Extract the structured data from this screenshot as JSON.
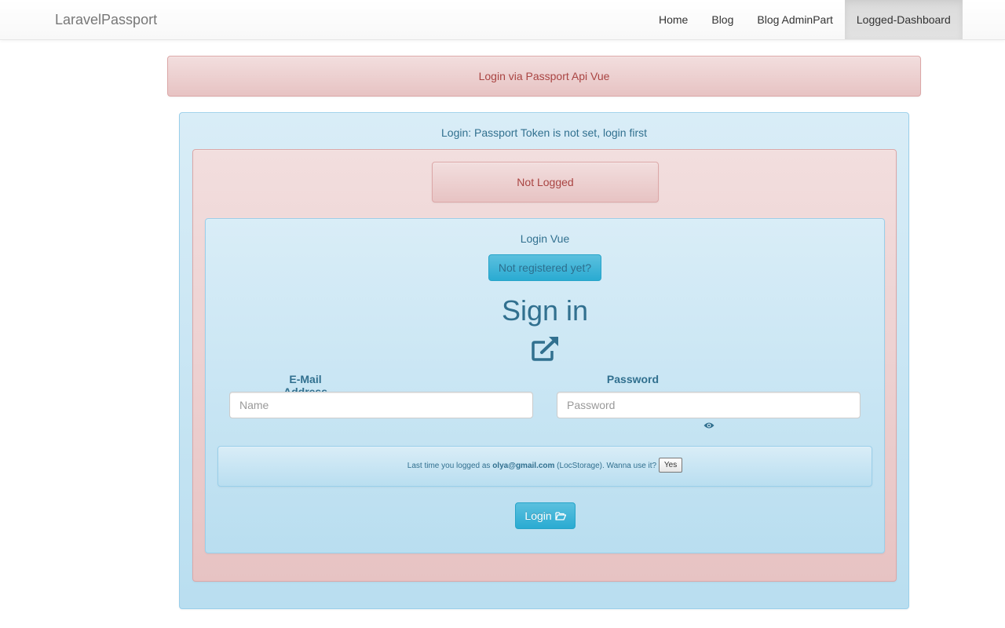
{
  "navbar": {
    "brand": "LaravelPassport",
    "items": [
      {
        "label": "Home"
      },
      {
        "label": "Blog"
      },
      {
        "label": "Blog AdminPart"
      },
      {
        "label": "Logged-Dashboard",
        "active": true
      }
    ]
  },
  "top_alert": "Login via Passport Api Vue",
  "login_panel": {
    "title": "Login: Passport Token is not set, login first",
    "status": "Not Logged",
    "vue_title": "Login Vue",
    "not_registered_button": "Not registered yet?",
    "heading": "Sign in",
    "heading_icon": "external-link-icon",
    "email_label": "E-Mail Address",
    "email_placeholder": "Name",
    "password_label": "Password",
    "password_placeholder": "Password",
    "password_toggle_icon": "eye-icon",
    "storage_notice": {
      "prefix": "Last time you logged as ",
      "email": "olya@gmail.com",
      "suffix": " (LocStorage). Wanna use it?",
      "yes_button": "Yes"
    },
    "login_button": "Login",
    "login_icon": "folder-open-icon"
  },
  "colors": {
    "danger_text": "#a94442",
    "info_text": "#31708f",
    "button_info": "#5bc0de"
  }
}
